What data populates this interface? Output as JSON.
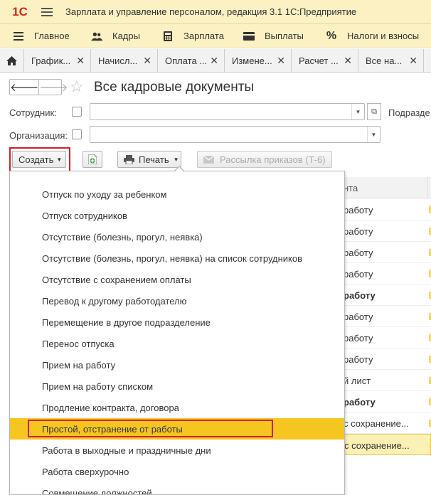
{
  "window": {
    "logo": "1С",
    "title": "Зарплата и управление персоналом, редакция 3.1 1С:Предприятие"
  },
  "sections": [
    {
      "label": "Главное",
      "icon": "hamburger-icon"
    },
    {
      "label": "Кадры",
      "icon": "people-icon"
    },
    {
      "label": "Зарплата",
      "icon": "calculator-icon"
    },
    {
      "label": "Выплаты",
      "icon": "wallet-icon"
    },
    {
      "label": "Налоги и взносы",
      "icon": "percent-icon"
    }
  ],
  "tabs": [
    {
      "label": "График..."
    },
    {
      "label": "Начисл..."
    },
    {
      "label": "Оплата ..."
    },
    {
      "label": "Измене..."
    },
    {
      "label": "Расчет ..."
    },
    {
      "label": "Все на..."
    }
  ],
  "form": {
    "title": "Все кадровые документы",
    "employee_label": "Сотрудник:",
    "department_label": "Подразде",
    "organization_label": "Организация:"
  },
  "commands": {
    "create": "Создать",
    "print": "Печать",
    "mailing": "Рассылка приказов (Т-6)"
  },
  "table": {
    "header": "нта",
    "rows": [
      {
        "text": "работу",
        "bold": false
      },
      {
        "text": "работу",
        "bold": false
      },
      {
        "text": "работу",
        "bold": false
      },
      {
        "text": "работу",
        "bold": false
      },
      {
        "text": "работу",
        "bold": true
      },
      {
        "text": "работу",
        "bold": false
      },
      {
        "text": "работу",
        "bold": false
      },
      {
        "text": "работу",
        "bold": false
      },
      {
        "text": "й лист",
        "bold": false
      },
      {
        "text": "работу",
        "bold": true
      },
      {
        "text": "с сохранение...",
        "bold": false
      },
      {
        "text": "с сохранение...",
        "bold": false
      }
    ]
  },
  "menu": {
    "items": [
      "Отпуск по уходу за ребенком",
      "Отпуск сотрудников",
      "Отсутствие (болезнь, прогул, неявка)",
      "Отсутствие (болезнь, прогул, неявка) на список сотрудников",
      "Отсутствие с сохранением оплаты",
      "Перевод к другому работодателю",
      "Перемещение в другое подразделение",
      "Перенос отпуска",
      "Прием на работу",
      "Прием на работу списком",
      "Продление контракта, договора",
      "Простой, отстранение от работы",
      "Работа в выходные и праздничные дни",
      "Работа сверхурочно",
      "Совмещение должностей"
    ],
    "active_index": 11
  },
  "colors": {
    "header_bg": "#fbf1c3",
    "active_item": "#f5c520",
    "highlight_border": "#d11f27"
  }
}
